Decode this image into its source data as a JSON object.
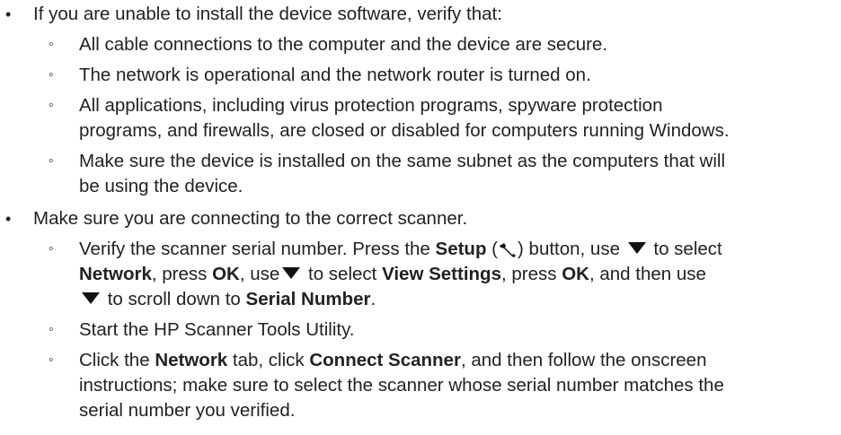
{
  "bullet_l1": "•",
  "bullet_l2": "◦",
  "item1": {
    "text": "If you are unable to install the device software, verify that:",
    "subitems": [
      "All cable connections to the computer and the device are secure.",
      "The network is operational and the network router is turned on.",
      "All applications, including virus protection programs, spyware protection",
      "programs, and firewalls, are closed or disabled for computers running Windows.",
      "Make sure the device is installed on the same subnet as the computers that will",
      "be using the device."
    ]
  },
  "item2": {
    "text": "Make sure you are connecting to the correct scanner.",
    "verify": {
      "t1": "Verify the scanner serial number. Press the ",
      "setup": "Setup",
      "t2": " (",
      "t3": ") button, use ",
      "t4": " to select",
      "network": "Network",
      "t5": ", press ",
      "ok": "OK",
      "t6": ", use",
      "t7": " to select ",
      "view_settings": "View Settings",
      "t8": ", press ",
      "ok2": "OK",
      "t9": ", and then use",
      "t10": " to scroll down to ",
      "serial_number": "Serial Number",
      "t11": "."
    },
    "start_tools": "Start the HP Scanner Tools Utility.",
    "click": {
      "t1": "Click the ",
      "network_tab": "Network",
      "t2": " tab, click ",
      "connect_scanner": "Connect Scanner",
      "t3": ", and then follow the onscreen",
      "line2": "instructions; make sure to select the scanner whose serial number matches the",
      "line3": "serial number you verified."
    }
  },
  "icons": {
    "setup": "wrench-icon",
    "down": "down-arrow-icon"
  }
}
